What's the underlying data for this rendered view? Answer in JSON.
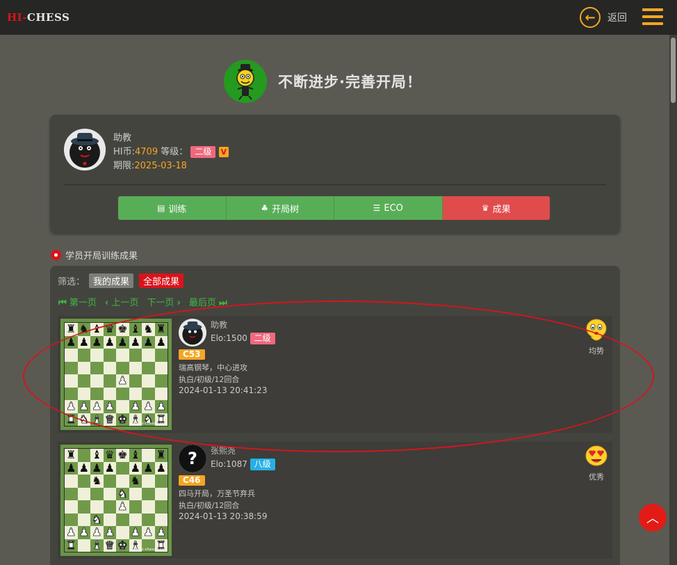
{
  "header": {
    "logo_hi": "HI-",
    "logo_chess": "CHESS",
    "back_label": "返回",
    "back_icon_glyph": "←",
    "accent": "#f5a623",
    "brand_red": "#d8141b"
  },
  "hero": {
    "title": "不断进步·完善开局！"
  },
  "profile": {
    "name": "助教",
    "coin_label": "HI币:",
    "coin_value": "4709",
    "level_label": "等级：",
    "level": "二级",
    "vip": "V",
    "expire_label": "期限:",
    "expire_value": "2025-03-18"
  },
  "tabs": [
    {
      "label": "训练",
      "icon": "book-icon",
      "glyph": "▤"
    },
    {
      "label": "开局树",
      "icon": "tree-icon",
      "glyph": "♣"
    },
    {
      "label": "ECO",
      "icon": "list-icon",
      "glyph": "☰"
    },
    {
      "label": "成果",
      "icon": "crown-icon",
      "glyph": "♛",
      "active": true
    }
  ],
  "section": {
    "title": "学员开局训练成果"
  },
  "filter": {
    "label": "筛选：",
    "mine": "我的成果",
    "all": "全部成果"
  },
  "pager": {
    "first": "第一页",
    "prev": "上一页",
    "next": "下一页",
    "last": "最后页",
    "first_glyph": "⏮",
    "prev_glyph": "‹",
    "next_glyph": "›",
    "last_glyph": "⏭"
  },
  "games": [
    {
      "player": "助教",
      "elo": "Elo:1500",
      "level": "二级",
      "level_color": "#f0697e",
      "eco": "C53",
      "opening": "瑞高钢琴，中心进攻",
      "info": "执白/初级/12回合",
      "time": "2024-01-13 20:41:23",
      "result": "均势",
      "watermark": "www.hi-chess.com"
    },
    {
      "player": "张熙尧",
      "elo": "Elo:1087",
      "level": "八级",
      "level_color": "#27b0e6",
      "eco": "C46",
      "opening": "四马开局，万圣节弃兵",
      "info": "执白/初级/12回合",
      "time": "2024-01-13 20:38:59",
      "result": "优秀",
      "watermark": "www.hi-chess.com"
    }
  ],
  "fab_glyph": "︿"
}
